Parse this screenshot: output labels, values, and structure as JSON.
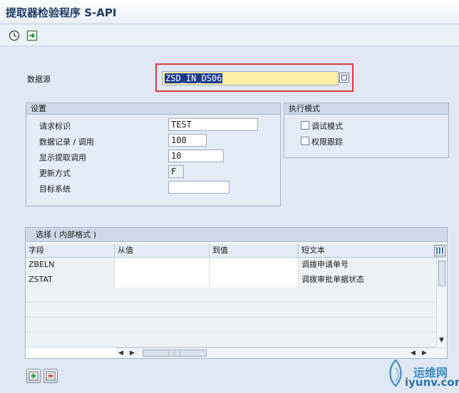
{
  "window": {
    "title": "提取器检验程序 S-API"
  },
  "toolbar": {
    "execute_icon": "execute-clock-icon",
    "variant_icon": "variant-save-icon"
  },
  "datasource": {
    "label": "数据源",
    "value": "ZSD_IN_DS06"
  },
  "settings": {
    "title": "设置",
    "rows": [
      {
        "label": "请求标识",
        "value": "TEST"
      },
      {
        "label": "数据记录 / 调用",
        "value": "100"
      },
      {
        "label": "显示提取调用",
        "value": "10"
      },
      {
        "label": "更新方式",
        "value": "F"
      },
      {
        "label": "目标系统",
        "value": ""
      }
    ]
  },
  "exec_mode": {
    "title": "执行模式",
    "options": [
      {
        "label": "调试模式",
        "checked": false
      },
      {
        "label": "权限跟踪",
        "checked": false
      }
    ]
  },
  "selection": {
    "title": "选择 ( 内部格式 )",
    "columns": [
      "字段",
      "从值",
      "到值",
      "短文本"
    ],
    "rows": [
      {
        "field": "ZBELN",
        "from": "",
        "to": "",
        "text": "调拨申请单号"
      },
      {
        "field": "ZSTAT",
        "from": "",
        "to": "",
        "text": "调拨审批单据状态"
      }
    ]
  },
  "watermark": {
    "cn": "运维网",
    "url": "iyunv.com"
  },
  "colors": {
    "focus_border": "#e03a3a",
    "input_highlight": "#fdeea5",
    "selection": "#1c3a8c"
  }
}
